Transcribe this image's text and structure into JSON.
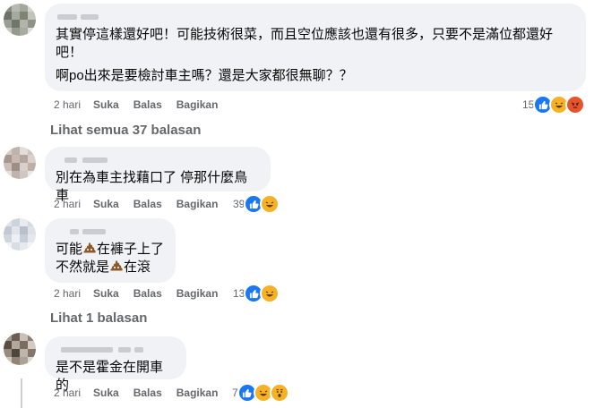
{
  "colors": {
    "like": "#1877f2",
    "meta": "#65676b",
    "bubble": "#f0f2f5"
  },
  "comments": [
    {
      "lines": [
        "其實停這樣還好吧！可能技術很菜，而且空位應該也還有很多，只要不是滿位都還好",
        "吧！",
        "啊po出來是要檢討車主嗎？還是大家都很無聊？？"
      ],
      "time": "2 hari",
      "like": "Suka",
      "reply": "Balas",
      "share": "Bagikan",
      "reaction_count": "15",
      "reaction_icons": [
        "like-icon",
        "haha-icon",
        "angry-icon"
      ]
    },
    {
      "lines": [
        "別在為車主找藉口了 停那什麼鳥車"
      ],
      "time": "2 hari",
      "like": "Suka",
      "reply": "Balas",
      "share": "Bagikan",
      "reaction_count": "39",
      "reaction_icons": [
        "like-icon",
        "haha-icon"
      ]
    },
    {
      "line1_before": "可能",
      "line1_after": "在褲子上了",
      "line2_before": "不然就是",
      "line2_after": "在滾",
      "time": "2 hari",
      "like": "Suka",
      "reply": "Balas",
      "share": "Bagikan",
      "reaction_count": "13",
      "reaction_icons": [
        "like-icon",
        "haha-icon"
      ]
    },
    {
      "lines": [
        "是不是霍金在開車的"
      ],
      "time": "2 hari",
      "like": "Suka",
      "reply": "Balas",
      "share": "Bagikan",
      "reaction_count": "7",
      "reaction_icons": [
        "like-icon",
        "haha-icon",
        "wow-icon"
      ]
    }
  ],
  "view_more": [
    "Lihat semua 37 balasan",
    "Lihat 1 balasan"
  ]
}
